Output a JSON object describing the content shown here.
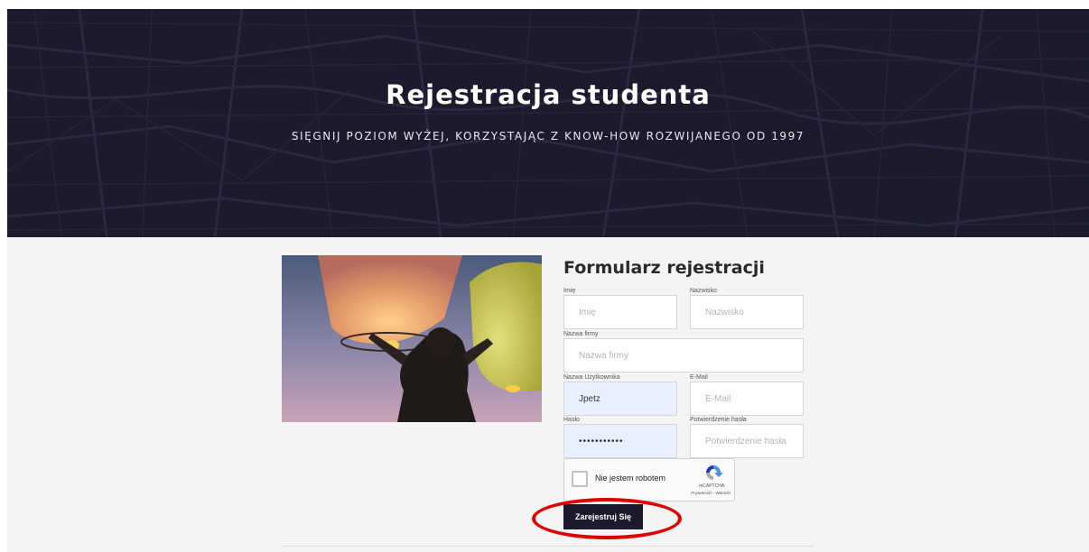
{
  "hero": {
    "title": "Rejestracja studenta",
    "subtitle": "SIĘGNIJ POZIOM WYŻEJ, KORZYSTAJĄC Z KNOW-HOW ROZWIJANEGO OD 1997"
  },
  "form": {
    "title": "Formularz rejestracji",
    "first_name": {
      "label": "Imię",
      "placeholder": "Imię",
      "value": ""
    },
    "last_name": {
      "label": "Nazwisko",
      "placeholder": "Nazwisko",
      "value": ""
    },
    "company": {
      "label": "Nazwa firmy",
      "placeholder": "Nazwa firmy",
      "value": ""
    },
    "username": {
      "label": "Nazwa Użytkownika",
      "placeholder": "Nazwa Użytkownika",
      "value": "Jpetz"
    },
    "email": {
      "label": "E-Mail",
      "placeholder": "E-Mail",
      "value": ""
    },
    "password": {
      "label": "Hasło",
      "placeholder": "Hasło",
      "value": "•••••••••••"
    },
    "password_confirm": {
      "label": "Potwierdzenie hasła",
      "placeholder": "Potwierdzenie hasła",
      "value": ""
    },
    "recaptcha": {
      "label": "Nie jestem robotem",
      "brand": "reCAPTCHA",
      "links": "Prywatność - Warunki",
      "icon": "recaptcha-logo-icon"
    },
    "submit_label": "Zarejestruj Się"
  },
  "colors": {
    "hero_bg": "#1c1b2d",
    "content_bg": "#f4f4f4",
    "autofill_bg": "#e8f0fe",
    "highlight": "#e00000"
  }
}
